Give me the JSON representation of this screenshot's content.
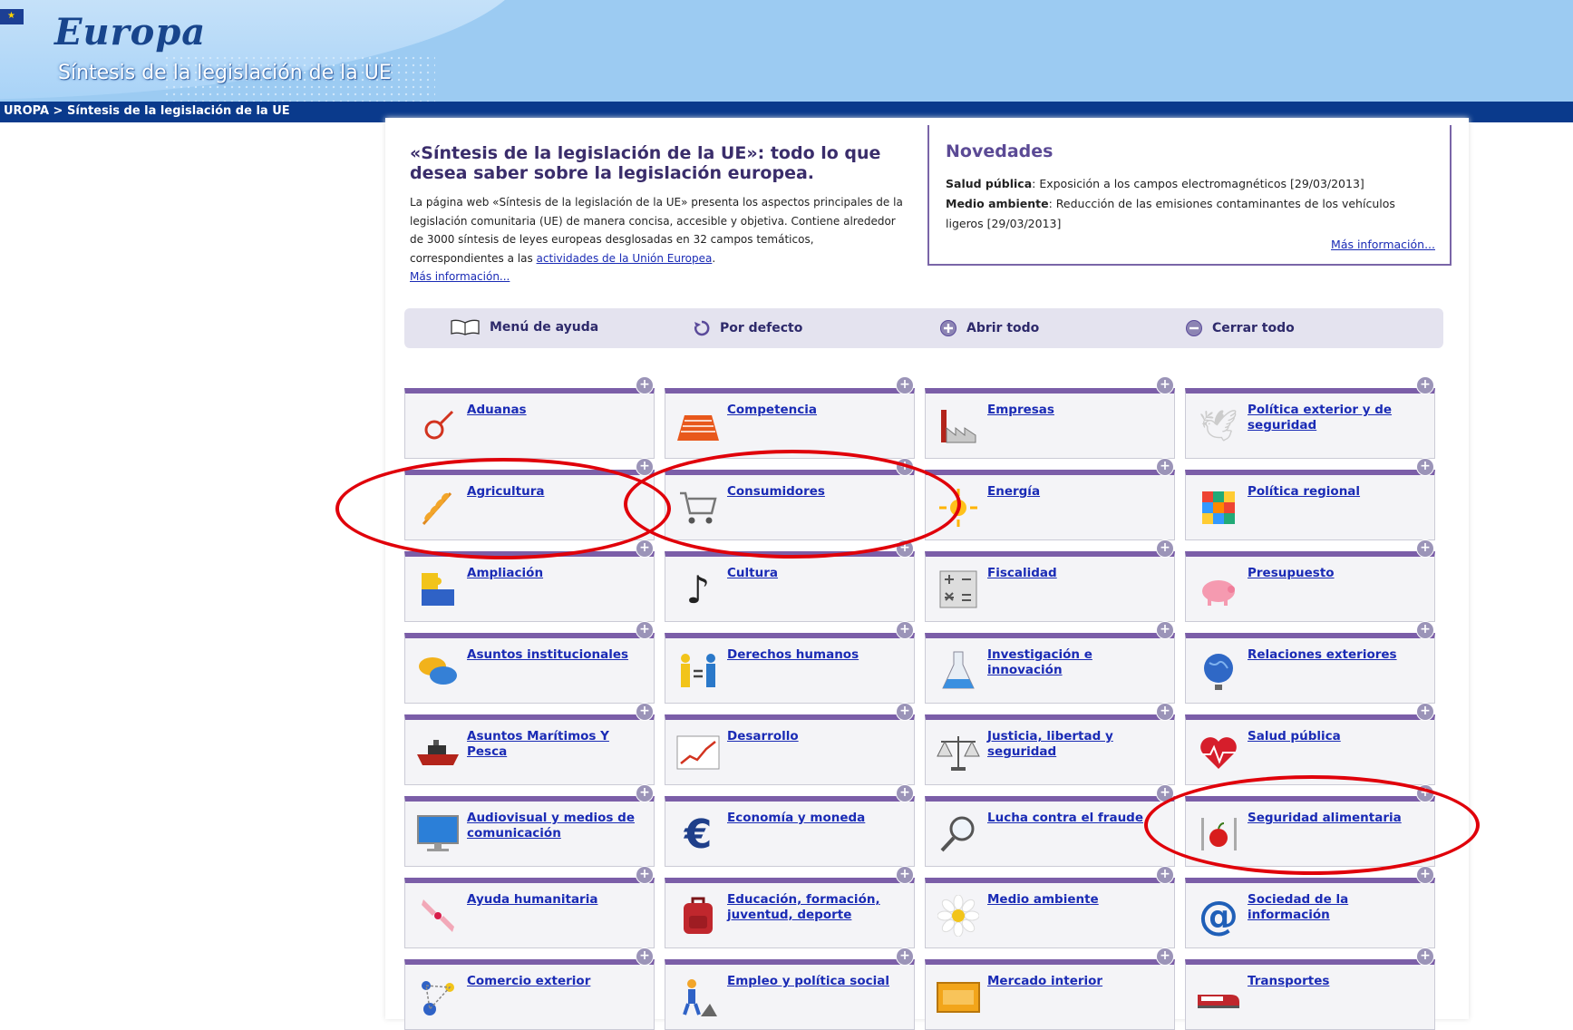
{
  "header": {
    "logo_text": "Europa",
    "subtitle": "Síntesis de la legislación de la UE",
    "breadcrumb": "UROPA > Síntesis de la legislación de la UE"
  },
  "intro": {
    "title": "«Síntesis de la legislación de la UE»: todo lo que desea saber sobre la legislación europea.",
    "text_before_link": "La página web «Síntesis de la legislación de la UE» presenta los aspectos principales de la legislación comunitaria (UE) de manera concisa, accesible y objetiva. Contiene alrededor de 3000 síntesis de leyes europeas desglosadas en 32 campos temáticos, correspondientes a las ",
    "activities_link": "actividades de la Unión Europea",
    "text_after_link": ".",
    "more_link": "Más información..."
  },
  "news": {
    "title": "Novedades",
    "items": [
      {
        "topic": "Salud pública",
        "text": ": Exposición a los campos electromagnéticos [29/03/2013]"
      },
      {
        "topic": "Medio ambiente",
        "text": ": Reducción de las emisiones contaminantes de los vehículos ligeros [29/03/2013]"
      }
    ],
    "more_link": "Más información..."
  },
  "toolbar": {
    "help": "Menú de ayuda",
    "default": "Por defecto",
    "open_all": "Abrir todo",
    "close_all": "Cerrar todo"
  },
  "topics": [
    {
      "label": "Aduanas",
      "icon": "magnifier-ring-icon"
    },
    {
      "label": "Competencia",
      "icon": "race-track-icon"
    },
    {
      "label": "Empresas",
      "icon": "factory-icon"
    },
    {
      "label": "Política exterior y de seguridad",
      "icon": "dove-icon"
    },
    {
      "label": "Agricultura",
      "icon": "wheat-icon"
    },
    {
      "label": "Consumidores",
      "icon": "shopping-cart-icon"
    },
    {
      "label": "Energía",
      "icon": "sun-icon"
    },
    {
      "label": "Política regional",
      "icon": "rubik-cube-icon"
    },
    {
      "label": "Ampliación",
      "icon": "puzzle-icon"
    },
    {
      "label": "Cultura",
      "icon": "music-note-icon"
    },
    {
      "label": "Fiscalidad",
      "icon": "calculator-icon"
    },
    {
      "label": "Presupuesto",
      "icon": "piggy-bank-icon"
    },
    {
      "label": "Asuntos institucionales",
      "icon": "speech-bubbles-icon"
    },
    {
      "label": "Derechos humanos",
      "icon": "equal-people-icon"
    },
    {
      "label": "Investigación e innovación",
      "icon": "flask-icon"
    },
    {
      "label": "Relaciones exteriores",
      "icon": "globe-icon"
    },
    {
      "label": "Asuntos Marítimos Y Pesca",
      "icon": "ship-icon"
    },
    {
      "label": "Desarrollo",
      "icon": "growth-chart-icon"
    },
    {
      "label": "Justicia, libertad y seguridad",
      "icon": "scales-icon"
    },
    {
      "label": "Salud pública",
      "icon": "heart-pulse-icon"
    },
    {
      "label": "Audiovisual y medios de comunicación",
      "icon": "monitor-icon"
    },
    {
      "label": "Economía y moneda",
      "icon": "euro-icon"
    },
    {
      "label": "Lucha contra el fraude",
      "icon": "magnifying-glass-icon"
    },
    {
      "label": "Seguridad alimentaria",
      "icon": "apple-cutlery-icon"
    },
    {
      "label": "Ayuda humanitaria",
      "icon": "helping-hands-icon"
    },
    {
      "label": "Educación, formación, juventud, deporte",
      "icon": "backpack-icon"
    },
    {
      "label": "Medio ambiente",
      "icon": "daisy-icon"
    },
    {
      "label": "Sociedad de la información",
      "icon": "at-sign-icon"
    },
    {
      "label": "Comercio exterior",
      "icon": "trade-network-icon"
    },
    {
      "label": "Empleo y política social",
      "icon": "worker-icon"
    },
    {
      "label": "Mercado interior",
      "icon": "market-board-icon"
    },
    {
      "label": "Transportes",
      "icon": "train-icon"
    }
  ],
  "colors": {
    "header_blue": "#9ccbf2",
    "breadcrumb_bar": "#0a3a8c",
    "tile_accent": "#7b5ea8",
    "link": "#1a2bb5",
    "annotation_red": "#e0000a"
  }
}
